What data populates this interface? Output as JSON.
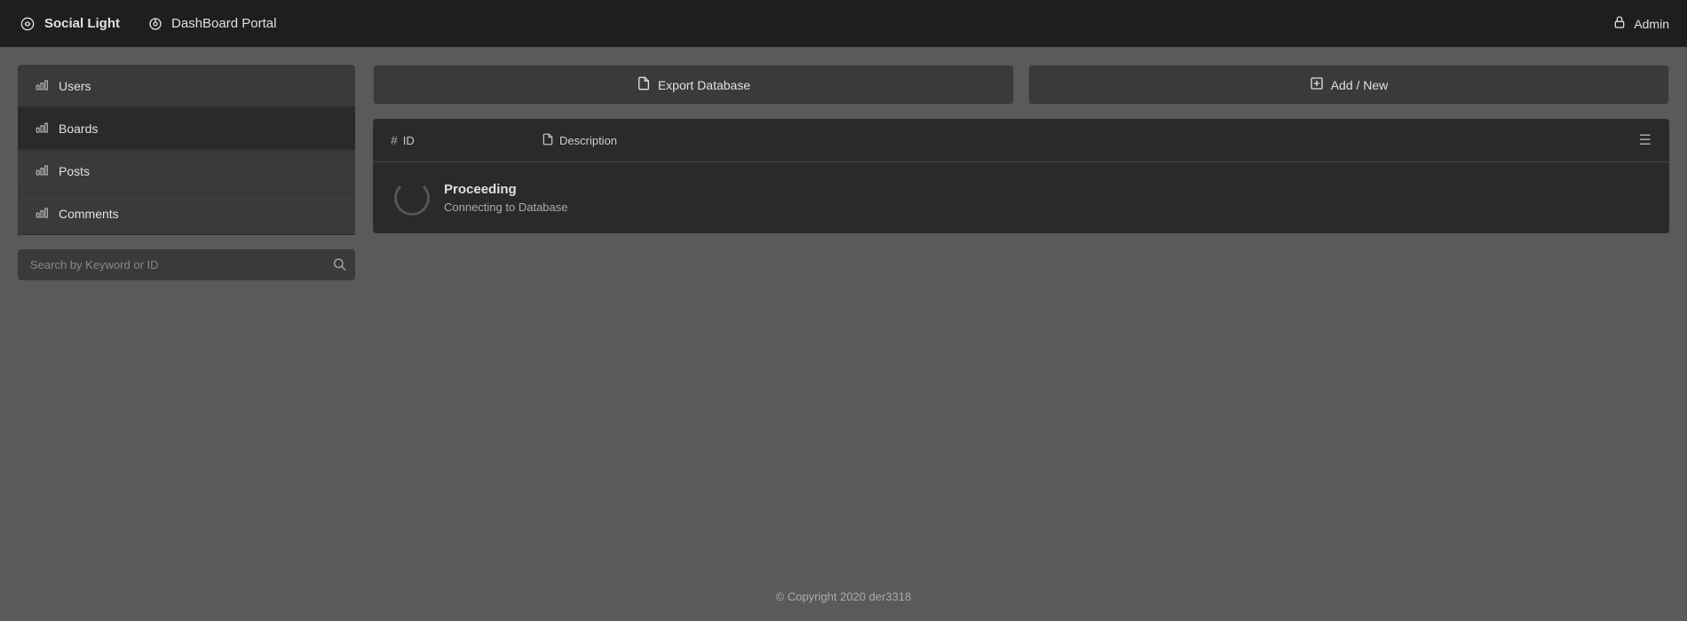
{
  "topnav": {
    "brand_label": "Social Light",
    "portal_label": "DashBoard Portal",
    "admin_label": "Admin"
  },
  "sidebar": {
    "items": [
      {
        "id": "users",
        "label": "Users"
      },
      {
        "id": "boards",
        "label": "Boards"
      },
      {
        "id": "posts",
        "label": "Posts"
      },
      {
        "id": "comments",
        "label": "Comments"
      }
    ],
    "search_placeholder": "Search by Keyword or ID"
  },
  "content": {
    "export_button_label": "Export Database",
    "add_button_label": "Add / New",
    "table": {
      "col_id": "ID",
      "col_description": "Description"
    },
    "proceeding": {
      "title": "Proceeding",
      "subtitle": "Connecting to Database"
    }
  },
  "footer": {
    "copyright": "© Copyright 2020 der3318"
  }
}
